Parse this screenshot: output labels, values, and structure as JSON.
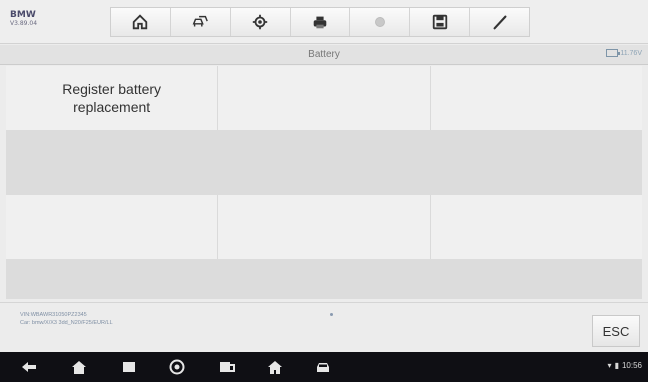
{
  "brand": {
    "make": "BMW",
    "version": "V3.89.04"
  },
  "toolbar": {
    "tools": [
      {
        "icon": "home-icon"
      },
      {
        "icon": "vehicle-swap-icon"
      },
      {
        "icon": "settings-icon"
      },
      {
        "icon": "print-icon"
      },
      {
        "icon": "disabled-icon"
      },
      {
        "icon": "save-icon"
      },
      {
        "icon": "pen-icon"
      }
    ]
  },
  "title": "Battery",
  "battery_voltage": "11.76V",
  "functions": {
    "row1": [
      "Register battery replacement",
      "",
      ""
    ],
    "row2": [
      "",
      "",
      ""
    ]
  },
  "vehicle_info": {
    "vin": "VIN:WBAWR31050PZ2345",
    "car": "Car: bmw/X/X3 3dd_N20/F25/EUR/LL"
  },
  "esc_label": "ESC",
  "nav": {
    "icons": [
      "back-icon",
      "home-icon",
      "recent-apps-icon",
      "browser-icon",
      "vci-icon",
      "house-icon",
      "car-icon"
    ],
    "time": "10:56"
  },
  "colors": {
    "background": "#ececec",
    "navbar": "#0f0f14",
    "accent": "#8da3b5"
  }
}
